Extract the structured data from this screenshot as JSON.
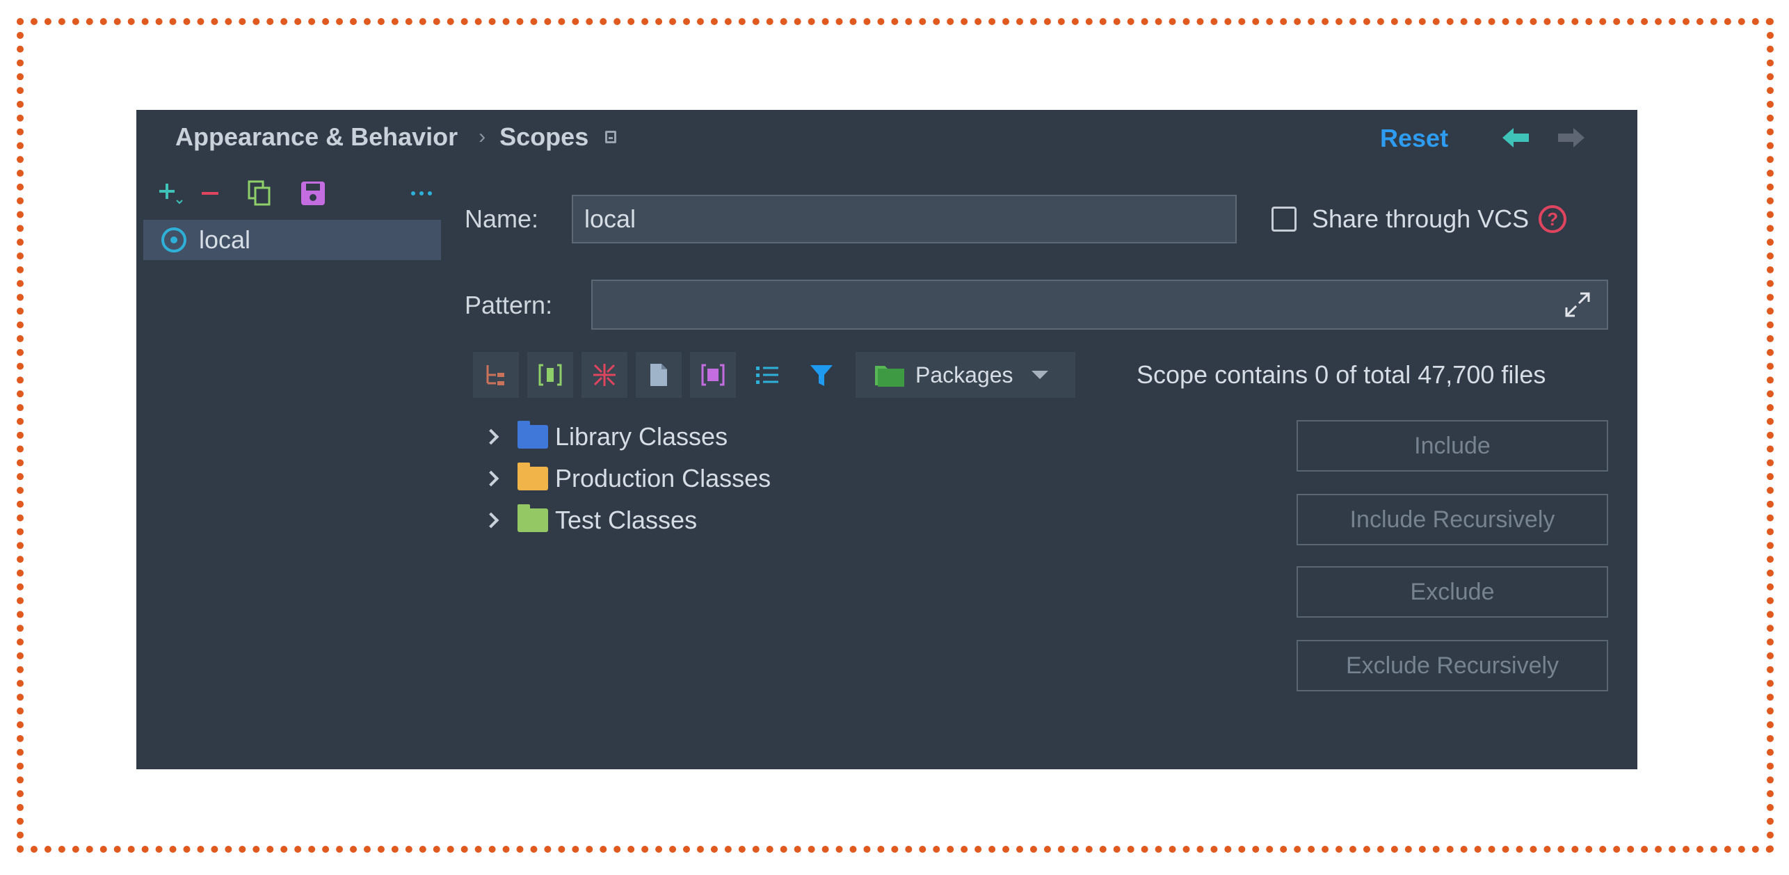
{
  "header": {
    "breadcrumb_parent": "Appearance & Behavior",
    "breadcrumb_separator": "›",
    "breadcrumb_current": "Scopes",
    "reset_label": "Reset"
  },
  "scopes_list": {
    "items": [
      {
        "label": "local"
      }
    ]
  },
  "form": {
    "name_label": "Name:",
    "name_value": "local",
    "share_label": "Share through VCS",
    "share_checked": false,
    "help_glyph": "?",
    "pattern_label": "Pattern:",
    "pattern_value": ""
  },
  "tree_toolbar": {
    "view_select_value": "Packages",
    "scope_summary": "Scope contains 0 of total 47,700 files"
  },
  "tree": {
    "items": [
      {
        "label": "Library Classes",
        "icon": "library-folder-icon"
      },
      {
        "label": "Production Classes",
        "icon": "source-folder-icon"
      },
      {
        "label": "Test Classes",
        "icon": "test-folder-icon"
      }
    ]
  },
  "actions": {
    "include": "Include",
    "include_recursively": "Include Recursively",
    "exclude": "Exclude",
    "exclude_recursively": "Exclude Recursively"
  },
  "colors": {
    "panel_bg": "#313b48",
    "accent_blue": "#2e9cf0",
    "frame_dots": "#e05a20",
    "selected_row": "#435166"
  }
}
